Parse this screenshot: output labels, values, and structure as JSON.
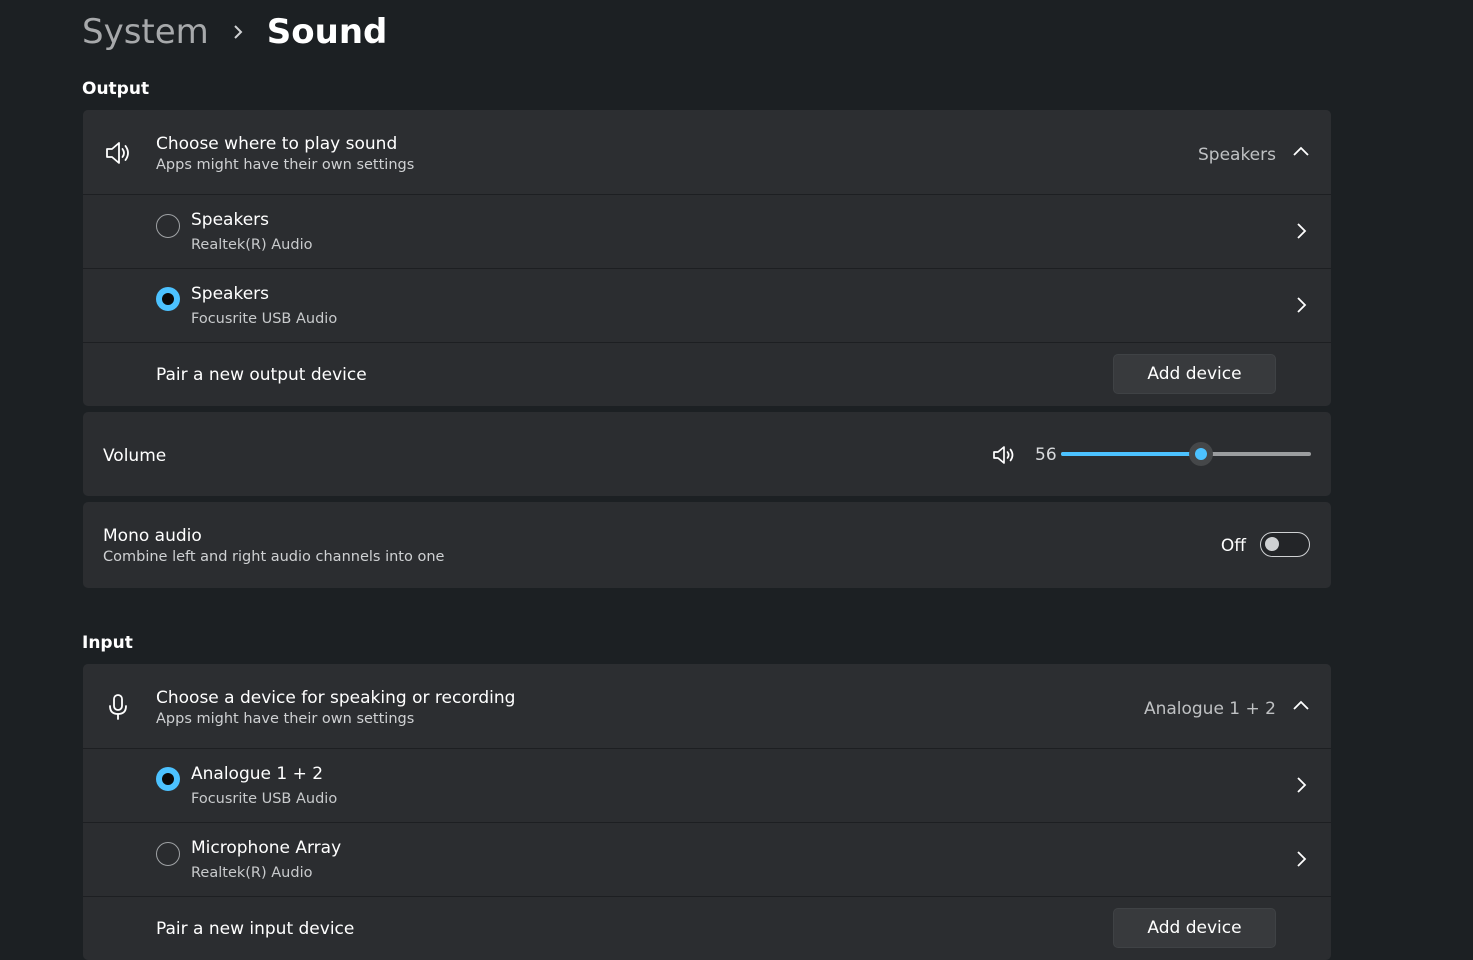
{
  "breadcrumb": {
    "parent": "System",
    "current": "Sound"
  },
  "output": {
    "section_title": "Output",
    "chooser": {
      "title": "Choose where to play sound",
      "subtitle": "Apps might have their own settings",
      "selected_value": "Speakers",
      "icon": "speaker-icon",
      "expanded": true
    },
    "devices": [
      {
        "name": "Speakers",
        "sub": "Realtek(R) Audio",
        "selected": false
      },
      {
        "name": "Speakers",
        "sub": "Focusrite USB Audio",
        "selected": true
      }
    ],
    "pair_label": "Pair a new output device",
    "add_button": "Add device"
  },
  "volume": {
    "label": "Volume",
    "value": "56",
    "level_percent": 56,
    "icon": "speaker-icon"
  },
  "mono": {
    "title": "Mono audio",
    "subtitle": "Combine left and right audio channels into one",
    "state_label": "Off",
    "on": false
  },
  "input": {
    "section_title": "Input",
    "chooser": {
      "title": "Choose a device for speaking or recording",
      "subtitle": "Apps might have their own settings",
      "selected_value": "Analogue 1 + 2",
      "icon": "microphone-icon",
      "expanded": true
    },
    "devices": [
      {
        "name": "Analogue 1 + 2",
        "sub": "Focusrite USB Audio",
        "selected": true
      },
      {
        "name": "Microphone Array",
        "sub": "Realtek(R) Audio",
        "selected": false
      }
    ],
    "pair_label": "Pair a new input device",
    "add_button": "Add device"
  },
  "colors": {
    "accent": "#4cc2ff",
    "background": "#1c2023",
    "card": "#2b2d30"
  }
}
